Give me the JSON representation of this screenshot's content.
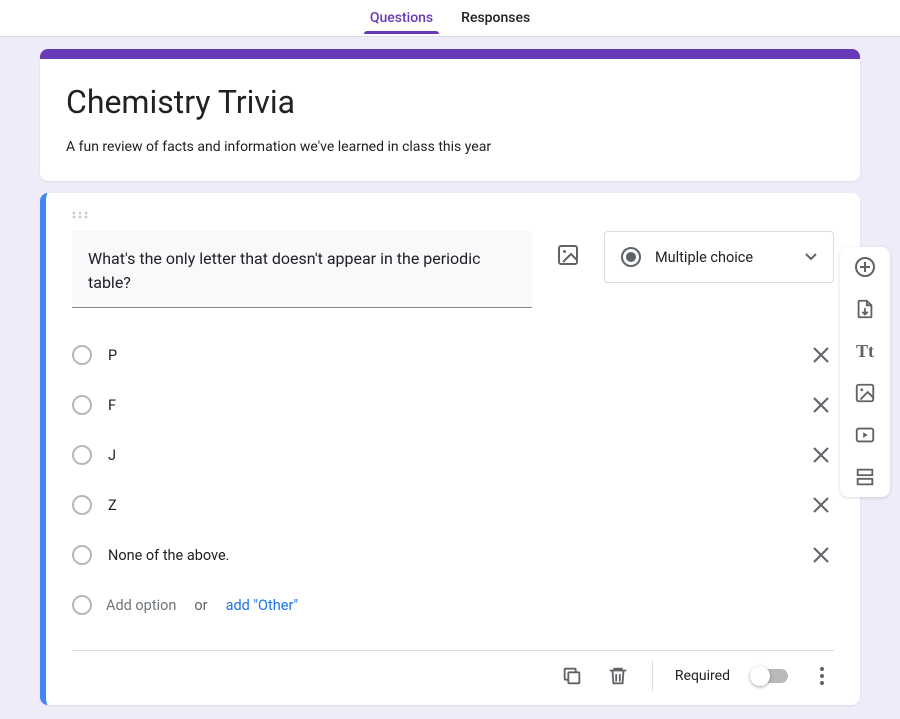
{
  "tabs": {
    "questions": "Questions",
    "responses": "Responses",
    "active": "questions"
  },
  "form": {
    "title": "Chemistry Trivia",
    "description": "A fun review of facts and information we've learned in class this year"
  },
  "question": {
    "text": "What's the only letter that doesn't appear in the periodic table?",
    "type_label": "Multiple choice",
    "options": [
      "P",
      "F",
      "J",
      "Z",
      "None of the above."
    ],
    "add_option_label": "Add option",
    "or_label": "or",
    "add_other_label": "add \"Other\""
  },
  "footer": {
    "required_label": "Required",
    "required_on": false
  },
  "toolbar_icons": {
    "add_question": "add-circle",
    "import": "import",
    "add_title": "Tt",
    "add_image": "image",
    "add_video": "video",
    "add_section": "section"
  }
}
